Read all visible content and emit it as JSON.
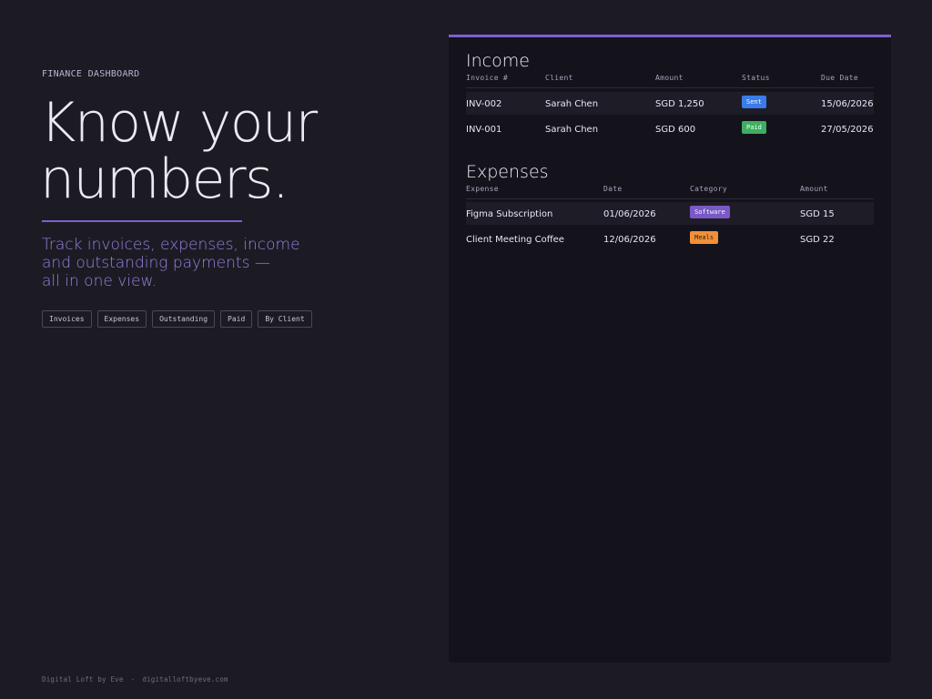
{
  "hero": {
    "eyebrow": "FINANCE DASHBOARD",
    "headline_lines": [
      "Know your",
      "numbers."
    ],
    "subhead_lines": [
      "Track invoices, expenses, income",
      "and outstanding payments —",
      "all in one view."
    ],
    "chips": [
      "Invoices",
      "Expenses",
      "Outstanding",
      "Paid",
      "By Client"
    ]
  },
  "footer": {
    "brand": "Digital Loft by Eve",
    "separator": "·",
    "site": "digitalloftbyeve.com"
  },
  "income": {
    "title": "Income",
    "columns": [
      "Invoice #",
      "Client",
      "Amount",
      "Status",
      "Due Date"
    ],
    "rows": [
      {
        "invoice": "INV-002",
        "client": "Sarah Chen",
        "amount": "SGD 1,250",
        "status": "Sent",
        "due": "15/06/2026"
      },
      {
        "invoice": "INV-001",
        "client": "Sarah Chen",
        "amount": "SGD 600",
        "status": "Paid",
        "due": "27/05/2026"
      }
    ]
  },
  "expenses": {
    "title": "Expenses",
    "columns": [
      "Expense",
      "Date",
      "Category",
      "Amount"
    ],
    "rows": [
      {
        "expense": "Figma Subscription",
        "date": "01/06/2026",
        "category": "Software",
        "amount": "SGD 15"
      },
      {
        "expense": "Client Meeting Coffee",
        "date": "12/06/2026",
        "category": "Meals",
        "amount": "SGD 22"
      }
    ]
  },
  "colors": {
    "accent": "#7d5fd1",
    "background": "#1c1b24",
    "panel": "#14131b",
    "status_sent": "#3b7bea",
    "status_paid": "#3fae62",
    "category_software": "#7a58c8",
    "category_meals": "#f0913a"
  }
}
